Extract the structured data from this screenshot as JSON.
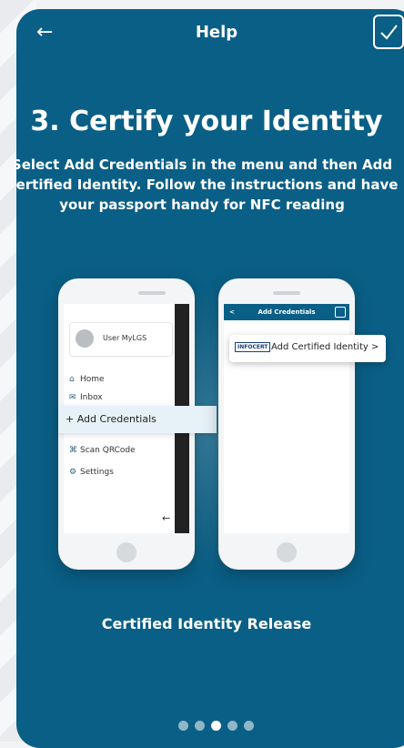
{
  "header": {
    "title": "Help"
  },
  "step": {
    "heading": "3. Certify your Identity",
    "description": "Select Add Credentials in the menu and then Add Certified Identity. Follow the instructions and have your passport handy for NFC reading"
  },
  "illustration": {
    "left_phone": {
      "user_name": "User MyLGS",
      "menu": [
        {
          "icon": "home-icon",
          "label": "Home"
        },
        {
          "icon": "inbox-icon",
          "label": "Inbox"
        },
        {
          "icon": "plus-icon",
          "label": "Add Credentials"
        },
        {
          "icon": "qrcode-icon",
          "label": "Scan QRCode"
        },
        {
          "icon": "gear-icon",
          "label": "Settings"
        }
      ]
    },
    "right_phone": {
      "header": "Add Credentials",
      "logo": "INFOCERT",
      "option": "Add Certified Identity >"
    }
  },
  "caption": "Certified Identity Release",
  "pagination": {
    "total": 5,
    "active": 3
  },
  "colors": {
    "background": "#0a5f86",
    "accent": "#e6f2f8"
  }
}
